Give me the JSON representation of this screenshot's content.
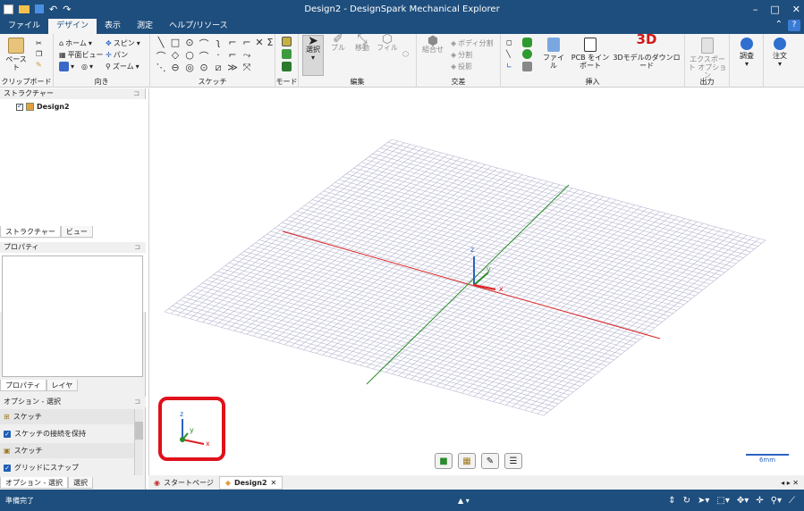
{
  "window": {
    "title": "Design2 - DesignSpark Mechanical Explorer",
    "minimize": "–",
    "maximize": "□",
    "close": "✕"
  },
  "quickaccess": {
    "undo": "↶",
    "redo": "↷"
  },
  "menu": {
    "tabs": [
      "ファイル",
      "デザイン",
      "表示",
      "測定",
      "ヘルプ/リソース"
    ],
    "active": 1,
    "collapse": "⌃",
    "help": "?"
  },
  "ribbon": {
    "clipboard": {
      "paste": "ペースト",
      "label": "クリップボード"
    },
    "orient": {
      "home": "ホーム",
      "plan": "平面ビュー",
      "spin": "スピン",
      "pan": "パン",
      "zoom": "ズーム",
      "label": "向き"
    },
    "sketch": {
      "label": "スケッチ"
    },
    "mode": {
      "label": "モード"
    },
    "edit": {
      "select": "選択",
      "pull": "プル",
      "move": "移動",
      "fill": "フィル",
      "label": "編集"
    },
    "intersect": {
      "combine": "組合せ",
      "split_body": "ボディ分割",
      "split": "分割",
      "project": "投影",
      "label": "交差"
    },
    "insert": {
      "file": "ファイル",
      "pcb": "PCB をイン ポート",
      "download_3d": "3Dモデルのダウンロード",
      "logo": "3D",
      "label": "挿入"
    },
    "output": {
      "export": "エクスポート オプション",
      "label": "出力"
    },
    "investigate": {
      "label": "調査"
    },
    "order": {
      "label": "注文"
    }
  },
  "structure": {
    "title": "ストラクチャー",
    "item": "Design2",
    "tab1": "ストラクチャー",
    "tab2": "ビュー"
  },
  "properties": {
    "title": "プロパティ",
    "tab1": "プロパティ",
    "tab2": "レイヤ"
  },
  "options": {
    "title": "オプション - 選択",
    "section1": "スケッチ",
    "opt1": "スケッチの接続を保持",
    "section2": "スケッチ",
    "opt2": "グリッドにスナップ",
    "tab1": "オプション - 選択",
    "tab2": "選択"
  },
  "viewport": {
    "axis_x": "x",
    "axis_y": "y",
    "axis_z": "z",
    "scale": "6mm"
  },
  "doctabs": {
    "start": "スタートページ",
    "design": "Design2",
    "close": "✕"
  },
  "status": {
    "text": "準備完了"
  },
  "colors": {
    "accent": "#1e4e7d",
    "grid": "#b8b8d2",
    "xaxis": "#dd2020",
    "yaxis": "#2a8c2a",
    "highlight": "#e0101a"
  }
}
